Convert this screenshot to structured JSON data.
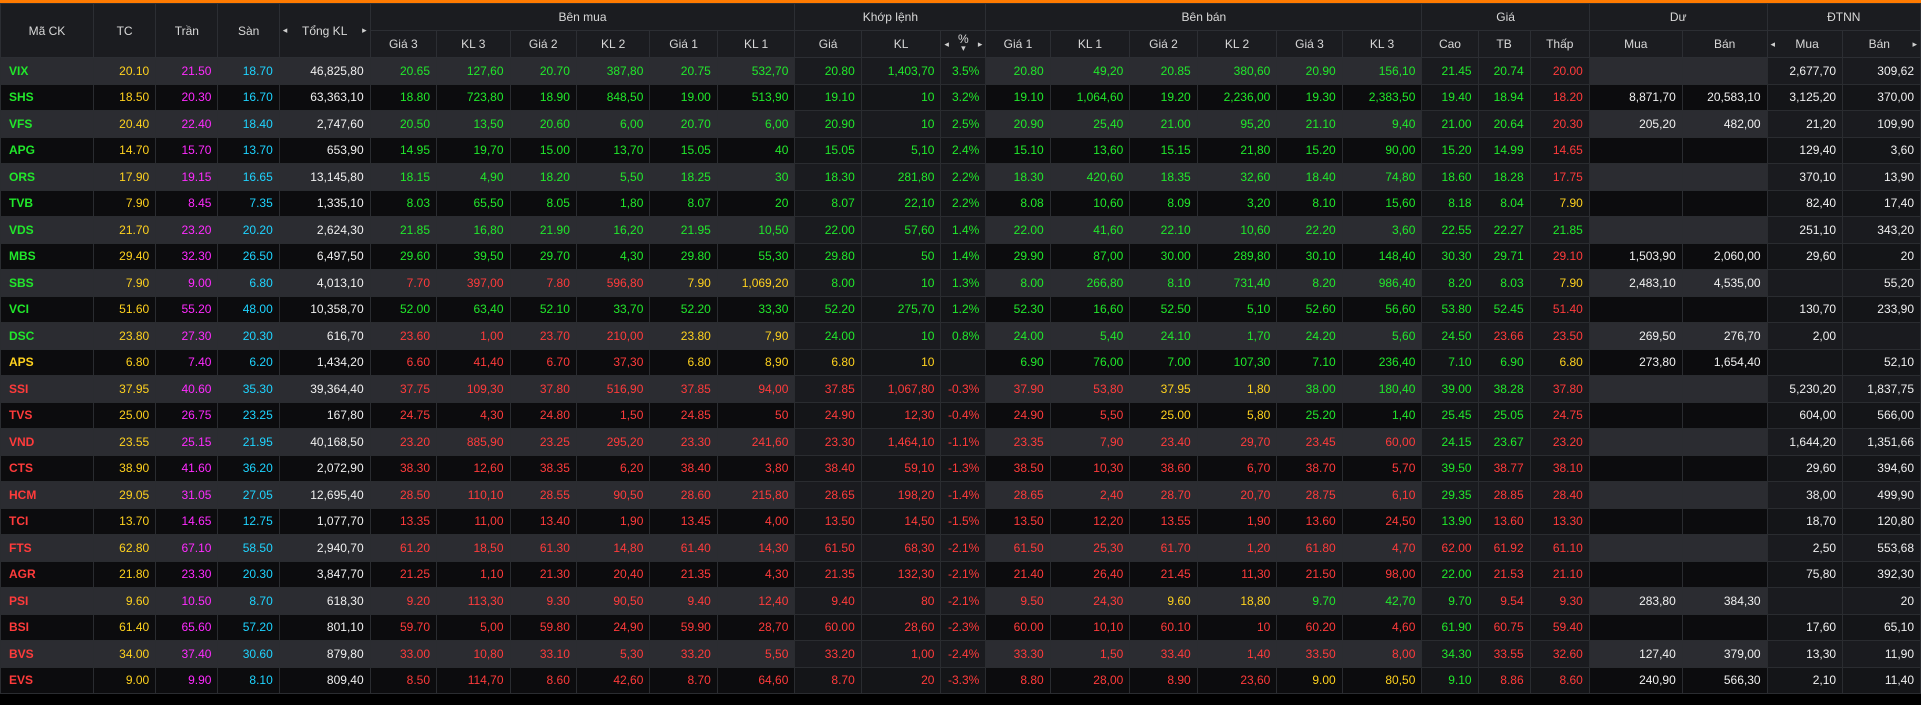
{
  "headers": {
    "symbol": "Mã CK",
    "tc": "TC",
    "tran": "Trần",
    "san": "Sàn",
    "total": "Tổng KL",
    "buy": "Bên mua",
    "match": "Khớp lệnh",
    "sell": "Bên bán",
    "price": "Giá",
    "du": "Dư",
    "dtnn": "ĐTNN",
    "gia3": "Giá 3",
    "kl3": "KL 3",
    "gia2": "Giá 2",
    "kl2": "KL 2",
    "gia1": "Giá 1",
    "kl1": "KL 1",
    "m_gia": "Giá",
    "m_kl": "KL",
    "m_pct": "%",
    "cao": "Cao",
    "tb": "TB",
    "thap": "Thấp",
    "mua": "Mua",
    "ban": "Bán"
  },
  "arrows": {
    "left": "◂",
    "right": "▸",
    "down": "▾"
  },
  "colors": {
    "up": "#21e82b",
    "down": "#ff3b3b",
    "ref": "#ffd21e",
    "ceiling": "#ff2bff",
    "floor": "#1ed4ff",
    "accent": "#ff7a00",
    "header_bg": "#1b1c20"
  },
  "rows": [
    {
      "s": "VIX",
      "t": "20.10",
      "c": "21.50",
      "f": "18.70",
      "v": "46,825,80",
      "b3": "20.65",
      "bk3": "127,60",
      "b2": "20.70",
      "bk2": "387,80",
      "b1": "20.75",
      "bk1": "532,70",
      "mp": "20.80",
      "mk": "1,403,70",
      "pc": "3.5%",
      "s1": "20.80",
      "sk1": "49,20",
      "s2": "20.85",
      "sk2": "380,60",
      "s3": "20.90",
      "sk3": "156,10",
      "hi": "21.45",
      "av": "20.74",
      "lo": "20.00",
      "dm": "",
      "db": "",
      "fm": "2,677,70",
      "fb": "309,62"
    },
    {
      "s": "SHS",
      "t": "18.50",
      "c": "20.30",
      "f": "16.70",
      "v": "63,363,10",
      "b3": "18.80",
      "bk3": "723,80",
      "b2": "18.90",
      "bk2": "848,50",
      "b1": "19.00",
      "bk1": "513,90",
      "mp": "19.10",
      "mk": "10",
      "pc": "3.2%",
      "s1": "19.10",
      "sk1": "1,064,60",
      "s2": "19.20",
      "sk2": "2,236,00",
      "s3": "19.30",
      "sk3": "2,383,50",
      "hi": "19.40",
      "av": "18.94",
      "lo": "18.20",
      "dm": "8,871,70",
      "db": "20,583,10",
      "fm": "3,125,20",
      "fb": "370,00"
    },
    {
      "s": "VFS",
      "t": "20.40",
      "c": "22.40",
      "f": "18.40",
      "v": "2,747,60",
      "b3": "20.50",
      "bk3": "13,50",
      "b2": "20.60",
      "bk2": "6,00",
      "b1": "20.70",
      "bk1": "6,00",
      "mp": "20.90",
      "mk": "10",
      "pc": "2.5%",
      "s1": "20.90",
      "sk1": "25,40",
      "s2": "21.00",
      "sk2": "95,20",
      "s3": "21.10",
      "sk3": "9,40",
      "hi": "21.00",
      "av": "20.64",
      "lo": "20.30",
      "dm": "205,20",
      "db": "482,00",
      "fm": "21,20",
      "fb": "109,90"
    },
    {
      "s": "APG",
      "t": "14.70",
      "c": "15.70",
      "f": "13.70",
      "v": "653,90",
      "b3": "14.95",
      "bk3": "19,70",
      "b2": "15.00",
      "bk2": "13,70",
      "b1": "15.05",
      "bk1": "40",
      "mp": "15.05",
      "mk": "5,10",
      "pc": "2.4%",
      "s1": "15.10",
      "sk1": "13,60",
      "s2": "15.15",
      "sk2": "21,80",
      "s3": "15.20",
      "sk3": "90,00",
      "hi": "15.20",
      "av": "14.99",
      "lo": "14.65",
      "dm": "",
      "db": "",
      "fm": "129,40",
      "fb": "3,60"
    },
    {
      "s": "ORS",
      "t": "17.90",
      "c": "19.15",
      "f": "16.65",
      "v": "13,145,80",
      "b3": "18.15",
      "bk3": "4,90",
      "b2": "18.20",
      "bk2": "5,50",
      "b1": "18.25",
      "bk1": "30",
      "mp": "18.30",
      "mk": "281,80",
      "pc": "2.2%",
      "s1": "18.30",
      "sk1": "420,60",
      "s2": "18.35",
      "sk2": "32,60",
      "s3": "18.40",
      "sk3": "74,80",
      "hi": "18.60",
      "av": "18.28",
      "lo": "17.75",
      "dm": "",
      "db": "",
      "fm": "370,10",
      "fb": "13,90"
    },
    {
      "s": "TVB",
      "t": "7.90",
      "c": "8.45",
      "f": "7.35",
      "v": "1,335,10",
      "b3": "8.03",
      "bk3": "65,50",
      "b2": "8.05",
      "bk2": "1,80",
      "b1": "8.07",
      "bk1": "20",
      "mp": "8.07",
      "mk": "22,10",
      "pc": "2.2%",
      "s1": "8.08",
      "sk1": "10,60",
      "s2": "8.09",
      "sk2": "3,20",
      "s3": "8.10",
      "sk3": "15,60",
      "hi": "8.18",
      "av": "8.04",
      "lo": "7.90",
      "dm": "",
      "db": "",
      "fm": "82,40",
      "fb": "17,40"
    },
    {
      "s": "VDS",
      "t": "21.70",
      "c": "23.20",
      "f": "20.20",
      "v": "2,624,30",
      "b3": "21.85",
      "bk3": "16,80",
      "b2": "21.90",
      "bk2": "16,20",
      "b1": "21.95",
      "bk1": "10,50",
      "mp": "22.00",
      "mk": "57,60",
      "pc": "1.4%",
      "s1": "22.00",
      "sk1": "41,60",
      "s2": "22.10",
      "sk2": "10,60",
      "s3": "22.20",
      "sk3": "3,60",
      "hi": "22.55",
      "av": "22.27",
      "lo": "21.85",
      "dm": "",
      "db": "",
      "fm": "251,10",
      "fb": "343,20"
    },
    {
      "s": "MBS",
      "t": "29.40",
      "c": "32.30",
      "f": "26.50",
      "v": "6,497,50",
      "b3": "29.60",
      "bk3": "39,50",
      "b2": "29.70",
      "bk2": "4,30",
      "b1": "29.80",
      "bk1": "55,30",
      "mp": "29.80",
      "mk": "50",
      "pc": "1.4%",
      "s1": "29.90",
      "sk1": "87,00",
      "s2": "30.00",
      "sk2": "289,80",
      "s3": "30.10",
      "sk3": "148,40",
      "hi": "30.30",
      "av": "29.71",
      "lo": "29.10",
      "dm": "1,503,90",
      "db": "2,060,00",
      "fm": "29,60",
      "fb": "20"
    },
    {
      "s": "SBS",
      "t": "7.90",
      "c": "9.00",
      "f": "6.80",
      "v": "4,013,10",
      "b3": "7.70",
      "bk3": "397,00",
      "b2": "7.80",
      "bk2": "596,80",
      "b1": "7.90",
      "bk1": "1,069,20",
      "mp": "8.00",
      "mk": "10",
      "pc": "1.3%",
      "s1": "8.00",
      "sk1": "266,80",
      "s2": "8.10",
      "sk2": "731,40",
      "s3": "8.20",
      "sk3": "986,40",
      "hi": "8.20",
      "av": "8.03",
      "lo": "7.90",
      "dm": "2,483,10",
      "db": "4,535,00",
      "fm": "",
      "fb": "55,20"
    },
    {
      "s": "VCI",
      "t": "51.60",
      "c": "55.20",
      "f": "48.00",
      "v": "10,358,70",
      "b3": "52.00",
      "bk3": "63,40",
      "b2": "52.10",
      "bk2": "33,70",
      "b1": "52.20",
      "bk1": "33,30",
      "mp": "52.20",
      "mk": "275,70",
      "pc": "1.2%",
      "s1": "52.30",
      "sk1": "16,60",
      "s2": "52.50",
      "sk2": "5,10",
      "s3": "52.60",
      "sk3": "56,60",
      "hi": "53.80",
      "av": "52.45",
      "lo": "51.40",
      "dm": "",
      "db": "",
      "fm": "130,70",
      "fb": "233,90"
    },
    {
      "s": "DSC",
      "t": "23.80",
      "c": "27.30",
      "f": "20.30",
      "v": "616,70",
      "b3": "23.60",
      "bk3": "1,00",
      "b2": "23.70",
      "bk2": "210,00",
      "b1": "23.80",
      "bk1": "7,90",
      "mp": "24.00",
      "mk": "10",
      "pc": "0.8%",
      "s1": "24.00",
      "sk1": "5,40",
      "s2": "24.10",
      "sk2": "1,70",
      "s3": "24.20",
      "sk3": "5,60",
      "hi": "24.50",
      "av": "23.66",
      "lo": "23.50",
      "dm": "269,50",
      "db": "276,70",
      "fm": "2,00",
      "fb": ""
    },
    {
      "s": "APS",
      "t": "6.80",
      "c": "7.40",
      "f": "6.20",
      "v": "1,434,20",
      "b3": "6.60",
      "bk3": "41,40",
      "b2": "6.70",
      "bk2": "37,30",
      "b1": "6.80",
      "bk1": "8,90",
      "mp": "6.80",
      "mk": "10",
      "pc": "",
      "s1": "6.90",
      "sk1": "76,00",
      "s2": "7.00",
      "sk2": "107,30",
      "s3": "7.10",
      "sk3": "236,40",
      "hi": "7.10",
      "av": "6.90",
      "lo": "6.80",
      "dm": "273,80",
      "db": "1,654,40",
      "fm": "",
      "fb": "52,10"
    },
    {
      "s": "SSI",
      "t": "37.95",
      "c": "40.60",
      "f": "35.30",
      "v": "39,364,40",
      "b3": "37.75",
      "bk3": "109,30",
      "b2": "37.80",
      "bk2": "516,90",
      "b1": "37.85",
      "bk1": "94,00",
      "mp": "37.85",
      "mk": "1,067,80",
      "pc": "-0.3%",
      "s1": "37.90",
      "sk1": "53,80",
      "s2": "37.95",
      "sk2": "1,80",
      "s3": "38.00",
      "sk3": "180,40",
      "hi": "39.00",
      "av": "38.28",
      "lo": "37.80",
      "dm": "",
      "db": "",
      "fm": "5,230,20",
      "fb": "1,837,75"
    },
    {
      "s": "TVS",
      "t": "25.00",
      "c": "26.75",
      "f": "23.25",
      "v": "167,80",
      "b3": "24.75",
      "bk3": "4,30",
      "b2": "24.80",
      "bk2": "1,50",
      "b1": "24.85",
      "bk1": "50",
      "mp": "24.90",
      "mk": "12,30",
      "pc": "-0.4%",
      "s1": "24.90",
      "sk1": "5,50",
      "s2": "25.00",
      "sk2": "5,80",
      "s3": "25.20",
      "sk3": "1,40",
      "hi": "25.45",
      "av": "25.05",
      "lo": "24.75",
      "dm": "",
      "db": "",
      "fm": "604,00",
      "fb": "566,00"
    },
    {
      "s": "VND",
      "t": "23.55",
      "c": "25.15",
      "f": "21.95",
      "v": "40,168,50",
      "b3": "23.20",
      "bk3": "885,90",
      "b2": "23.25",
      "bk2": "295,20",
      "b1": "23.30",
      "bk1": "241,60",
      "mp": "23.30",
      "mk": "1,464,10",
      "pc": "-1.1%",
      "s1": "23.35",
      "sk1": "7,90",
      "s2": "23.40",
      "sk2": "29,70",
      "s3": "23.45",
      "sk3": "60,00",
      "hi": "24.15",
      "av": "23.67",
      "lo": "23.20",
      "dm": "",
      "db": "",
      "fm": "1,644,20",
      "fb": "1,351,66"
    },
    {
      "s": "CTS",
      "t": "38.90",
      "c": "41.60",
      "f": "36.20",
      "v": "2,072,90",
      "b3": "38.30",
      "bk3": "12,60",
      "b2": "38.35",
      "bk2": "6,20",
      "b1": "38.40",
      "bk1": "3,80",
      "mp": "38.40",
      "mk": "59,10",
      "pc": "-1.3%",
      "s1": "38.50",
      "sk1": "10,30",
      "s2": "38.60",
      "sk2": "6,70",
      "s3": "38.70",
      "sk3": "5,70",
      "hi": "39.50",
      "av": "38.77",
      "lo": "38.10",
      "dm": "",
      "db": "",
      "fm": "29,60",
      "fb": "394,60"
    },
    {
      "s": "HCM",
      "t": "29.05",
      "c": "31.05",
      "f": "27.05",
      "v": "12,695,40",
      "b3": "28.50",
      "bk3": "110,10",
      "b2": "28.55",
      "bk2": "90,50",
      "b1": "28.60",
      "bk1": "215,80",
      "mp": "28.65",
      "mk": "198,20",
      "pc": "-1.4%",
      "s1": "28.65",
      "sk1": "2,40",
      "s2": "28.70",
      "sk2": "20,70",
      "s3": "28.75",
      "sk3": "6,10",
      "hi": "29.35",
      "av": "28.85",
      "lo": "28.40",
      "dm": "",
      "db": "",
      "fm": "38,00",
      "fb": "499,90"
    },
    {
      "s": "TCI",
      "t": "13.70",
      "c": "14.65",
      "f": "12.75",
      "v": "1,077,70",
      "b3": "13.35",
      "bk3": "11,00",
      "b2": "13.40",
      "bk2": "1,90",
      "b1": "13.45",
      "bk1": "4,00",
      "mp": "13.50",
      "mk": "14,50",
      "pc": "-1.5%",
      "s1": "13.50",
      "sk1": "12,20",
      "s2": "13.55",
      "sk2": "1,90",
      "s3": "13.60",
      "sk3": "24,50",
      "hi": "13.90",
      "av": "13.60",
      "lo": "13.30",
      "dm": "",
      "db": "",
      "fm": "18,70",
      "fb": "120,80"
    },
    {
      "s": "FTS",
      "t": "62.80",
      "c": "67.10",
      "f": "58.50",
      "v": "2,940,70",
      "b3": "61.20",
      "bk3": "18,50",
      "b2": "61.30",
      "bk2": "14,80",
      "b1": "61.40",
      "bk1": "14,30",
      "mp": "61.50",
      "mk": "68,30",
      "pc": "-2.1%",
      "s1": "61.50",
      "sk1": "25,30",
      "s2": "61.70",
      "sk2": "1,20",
      "s3": "61.80",
      "sk3": "4,70",
      "hi": "62.00",
      "av": "61.92",
      "lo": "61.10",
      "dm": "",
      "db": "",
      "fm": "2,50",
      "fb": "553,68"
    },
    {
      "s": "AGR",
      "t": "21.80",
      "c": "23.30",
      "f": "20.30",
      "v": "3,847,70",
      "b3": "21.25",
      "bk3": "1,10",
      "b2": "21.30",
      "bk2": "20,40",
      "b1": "21.35",
      "bk1": "4,30",
      "mp": "21.35",
      "mk": "132,30",
      "pc": "-2.1%",
      "s1": "21.40",
      "sk1": "26,40",
      "s2": "21.45",
      "sk2": "11,30",
      "s3": "21.50",
      "sk3": "98,00",
      "hi": "22.00",
      "av": "21.53",
      "lo": "21.10",
      "dm": "",
      "db": "",
      "fm": "75,80",
      "fb": "392,30"
    },
    {
      "s": "PSI",
      "t": "9.60",
      "c": "10.50",
      "f": "8.70",
      "v": "618,30",
      "b3": "9.20",
      "bk3": "113,30",
      "b2": "9.30",
      "bk2": "90,50",
      "b1": "9.40",
      "bk1": "12,40",
      "mp": "9.40",
      "mk": "80",
      "pc": "-2.1%",
      "s1": "9.50",
      "sk1": "24,30",
      "s2": "9.60",
      "sk2": "18,80",
      "s3": "9.70",
      "sk3": "42,70",
      "hi": "9.70",
      "av": "9.54",
      "lo": "9.30",
      "dm": "283,80",
      "db": "384,30",
      "fm": "",
      "fb": "20"
    },
    {
      "s": "BSI",
      "t": "61.40",
      "c": "65.60",
      "f": "57.20",
      "v": "801,10",
      "b3": "59.70",
      "bk3": "5,00",
      "b2": "59.80",
      "bk2": "24,90",
      "b1": "59.90",
      "bk1": "28,70",
      "mp": "60.00",
      "mk": "28,60",
      "pc": "-2.3%",
      "s1": "60.00",
      "sk1": "10,10",
      "s2": "60.10",
      "sk2": "10",
      "s3": "60.20",
      "sk3": "4,60",
      "hi": "61.90",
      "av": "60.75",
      "lo": "59.40",
      "dm": "",
      "db": "",
      "fm": "17,60",
      "fb": "65,10"
    },
    {
      "s": "BVS",
      "t": "34.00",
      "c": "37.40",
      "f": "30.60",
      "v": "879,80",
      "b3": "33.00",
      "bk3": "10,80",
      "b2": "33.10",
      "bk2": "5,30",
      "b1": "33.20",
      "bk1": "5,50",
      "mp": "33.20",
      "mk": "1,00",
      "pc": "-2.4%",
      "s1": "33.30",
      "sk1": "1,50",
      "s2": "33.40",
      "sk2": "1,40",
      "s3": "33.50",
      "sk3": "8,00",
      "hi": "34.30",
      "av": "33.55",
      "lo": "32.60",
      "dm": "127,40",
      "db": "379,00",
      "fm": "13,30",
      "fb": "11,90"
    },
    {
      "s": "EVS",
      "t": "9.00",
      "c": "9.90",
      "f": "8.10",
      "v": "809,40",
      "b3": "8.50",
      "bk3": "114,70",
      "b2": "8.60",
      "bk2": "42,60",
      "b1": "8.70",
      "bk1": "64,60",
      "mp": "8.70",
      "mk": "20",
      "pc": "-3.3%",
      "s1": "8.80",
      "sk1": "28,00",
      "s2": "8.90",
      "sk2": "23,60",
      "s3": "9.00",
      "sk3": "80,50",
      "hi": "9.10",
      "av": "8.86",
      "lo": "8.60",
      "dm": "240,90",
      "db": "566,30",
      "fm": "2,10",
      "fb": "11,40"
    }
  ]
}
